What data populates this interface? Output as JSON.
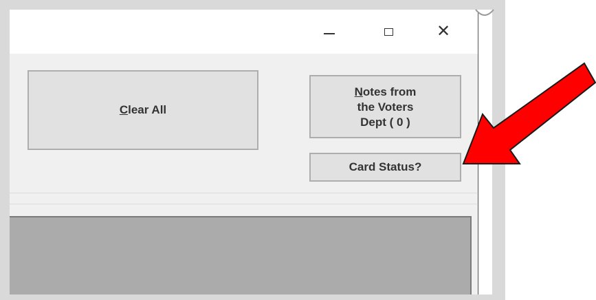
{
  "window": {
    "caption_buttons": {
      "minimize": "minimize-icon",
      "maximize": "maximize-icon",
      "close": "close-icon"
    },
    "close_glyph": "✕"
  },
  "buttons": {
    "clear_all": {
      "mnemonic": "C",
      "rest": "lear All"
    },
    "notes": {
      "line1_mnemonic": "N",
      "line1_rest": "otes from",
      "line2": "the Voters",
      "line3": "Dept ( 0 )"
    },
    "card_status": "Card Status?"
  },
  "annotation": {
    "arrow_color": "#ff0000",
    "arrow_outline": "#1a1a1a"
  },
  "colors": {
    "window_bg": "#f0f0f0",
    "button_bg": "#e1e1e1",
    "panel_gray": "#ababab"
  }
}
